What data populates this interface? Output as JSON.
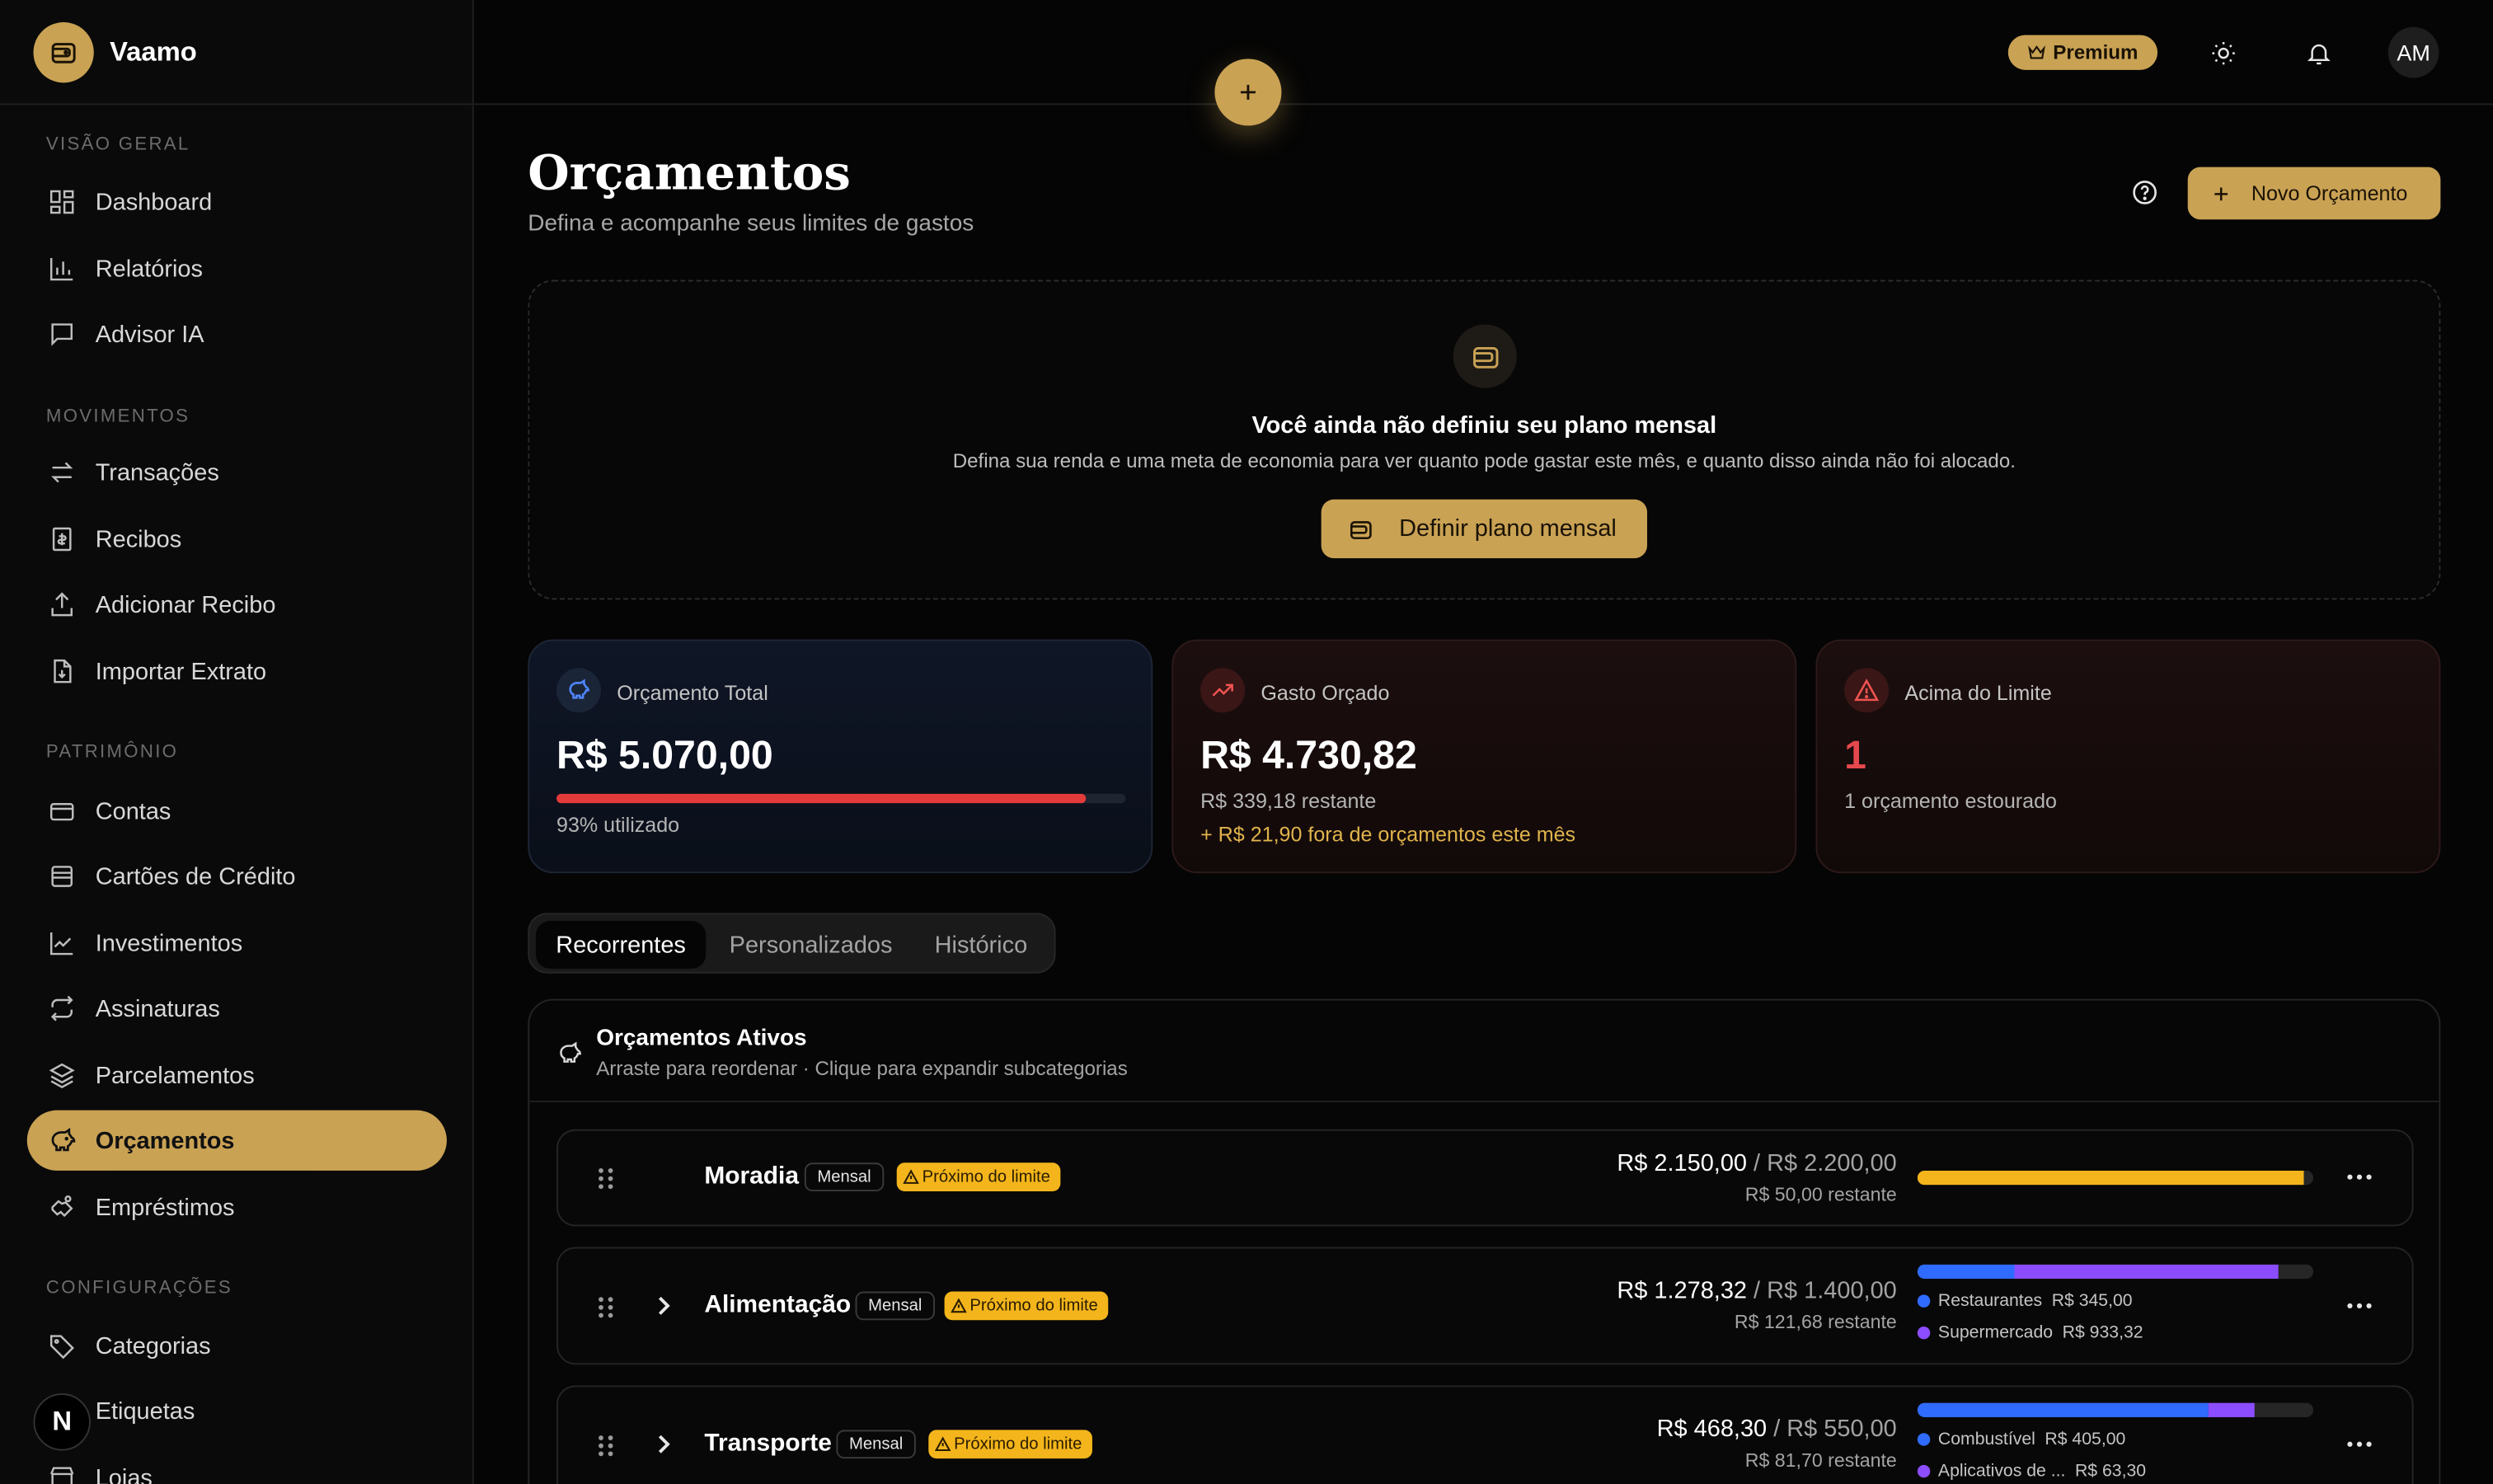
{
  "brand": {
    "name": "Vaamo"
  },
  "sidebar": {
    "sections": [
      "Visão geral",
      "Movimentos",
      "Patrimônio",
      "Configurações"
    ],
    "items": [
      {
        "label": "Dashboard",
        "icon": "dashboard-icon"
      },
      {
        "label": "Relatórios",
        "icon": "bar-chart-icon"
      },
      {
        "label": "Advisor IA",
        "icon": "message-icon"
      },
      {
        "label": "Transações",
        "icon": "arrows-icon"
      },
      {
        "label": "Recibos",
        "icon": "receipt-icon"
      },
      {
        "label": "Adicionar Recibo",
        "icon": "upload-icon"
      },
      {
        "label": "Importar Extrato",
        "icon": "file-import-icon"
      },
      {
        "label": "Contas",
        "icon": "card-icon"
      },
      {
        "label": "Cartões de Crédito",
        "icon": "credit-card-icon"
      },
      {
        "label": "Investimentos",
        "icon": "line-chart-icon"
      },
      {
        "label": "Assinaturas",
        "icon": "repeat-icon"
      },
      {
        "label": "Parcelamentos",
        "icon": "layers-icon"
      },
      {
        "label": "Orçamentos",
        "icon": "piggy-bank-icon",
        "active": true
      },
      {
        "label": "Empréstimos",
        "icon": "handshake-icon"
      },
      {
        "label": "Categorias",
        "icon": "tag-icon"
      },
      {
        "label": "Etiquetas",
        "icon": "label-icon"
      },
      {
        "label": "Lojas",
        "icon": "store-icon"
      }
    ],
    "n_badge": "N"
  },
  "topbar": {
    "premium_label": "Premium",
    "avatar_initials": "AM"
  },
  "header": {
    "title": "Orçamentos",
    "subtitle": "Defina e acompanhe seus limites de gastos",
    "new_button": "Novo Orçamento"
  },
  "plan": {
    "title": "Você ainda não definiu seu plano mensal",
    "description": "Defina sua renda e uma meta de economia para ver quanto pode gastar este mês, e quanto disso ainda não foi alocado.",
    "button": "Definir plano mensal"
  },
  "stats": {
    "total": {
      "label": "Orçamento Total",
      "value": "R$ 5.070,00",
      "used_pct": 93,
      "used_text": "93% utilizado"
    },
    "spent": {
      "label": "Gasto Orçado",
      "value": "R$ 4.730,82",
      "remaining": "R$ 339,18 restante",
      "outside": "+ R$ 21,90 fora de orçamentos este mês"
    },
    "over": {
      "label": "Acima do Limite",
      "value": "1",
      "sub": "1 orçamento estourado"
    }
  },
  "tabs": [
    "Recorrentes",
    "Personalizados",
    "Histórico"
  ],
  "budgets": {
    "title": "Orçamentos Ativos",
    "subtitle": "Arraste para reordenar · Clique para expandir subcategorias",
    "rows": [
      {
        "name": "Moradia",
        "period": "Mensal",
        "status": "Próximo do limite",
        "spent": "R$ 2.150,00",
        "limit": "/ R$ 2.200,00",
        "remaining": "R$ 50,00 restante",
        "segments": [
          {
            "fraction": 0.977,
            "color": "#f3b51b"
          }
        ],
        "legend": []
      },
      {
        "name": "Alimentação",
        "period": "Mensal",
        "status": "Próximo do limite",
        "spent": "R$ 1.278,32",
        "limit": "/ R$ 1.400,00",
        "remaining": "R$ 121,68 restante",
        "segments": [
          {
            "fraction": 0.246,
            "color": "#2f6bff"
          },
          {
            "fraction": 0.667,
            "color": "#8b4dff"
          }
        ],
        "legend": [
          {
            "name": "Restaurantes",
            "value": "R$ 345,00",
            "color": "#2f6bff"
          },
          {
            "name": "Supermercado",
            "value": "R$ 933,32",
            "color": "#8b4dff"
          }
        ]
      },
      {
        "name": "Transporte",
        "period": "Mensal",
        "status": "Próximo do limite",
        "spent": "R$ 468,30",
        "limit": "/ R$ 550,00",
        "remaining": "R$ 81,70 restante",
        "segments": [
          {
            "fraction": 0.736,
            "color": "#2f6bff"
          },
          {
            "fraction": 0.115,
            "color": "#8b4dff"
          }
        ],
        "legend": [
          {
            "name": "Combustível",
            "value": "R$ 405,00",
            "color": "#2f6bff"
          },
          {
            "name": "Aplicativos de ...",
            "value": "R$ 63,30",
            "color": "#8b4dff"
          }
        ]
      }
    ]
  },
  "colors": {
    "accent": "#c9a254",
    "danger": "#e33a3a",
    "warning": "#f3b51b"
  }
}
